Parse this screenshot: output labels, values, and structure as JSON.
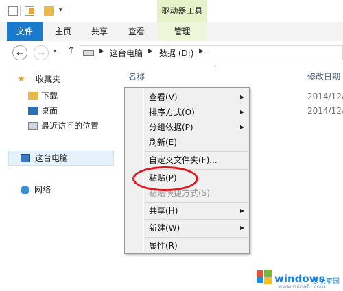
{
  "title_bar": {
    "drive_tools": "驱动器工具"
  },
  "ribbon": {
    "tabs": [
      "文件",
      "主页",
      "共享",
      "查看",
      "管理"
    ]
  },
  "address": {
    "crumbs": [
      "这台电脑",
      "数据 (D:)"
    ]
  },
  "sidebar": {
    "favorites": "收藏夹",
    "items": [
      "下载",
      "桌面",
      "最近访问的位置"
    ],
    "this_pc": "这台电脑",
    "network": "网络"
  },
  "columns": {
    "name": "名称",
    "date": "修改日期"
  },
  "files": [
    {
      "date": "2014/12/"
    },
    {
      "date": "2014/12/"
    }
  ],
  "context_menu": {
    "items": [
      {
        "label": "查看(V)",
        "submenu": true
      },
      {
        "label": "排序方式(O)",
        "submenu": true
      },
      {
        "label": "分组依据(P)",
        "submenu": true
      },
      {
        "label": "刷新(E)",
        "submenu": false
      },
      {
        "label": "自定义文件夹(F)...",
        "submenu": false
      },
      {
        "label": "粘贴(P)",
        "submenu": false
      },
      {
        "label": "粘贴快捷方式(S)",
        "submenu": false,
        "disabled": true
      },
      {
        "label": "共享(H)",
        "submenu": true
      },
      {
        "label": "新建(W)",
        "submenu": true
      },
      {
        "label": "属性(R)",
        "submenu": false
      }
    ],
    "arrow": "▶"
  },
  "watermark": {
    "brand": "windows",
    "sub": "系统家园",
    "url": "www.ruinafu.com"
  },
  "colors": {
    "accent": "#1979ca",
    "highlight": "#e3151c",
    "drive_tools_bg": "#e6f2c8"
  }
}
